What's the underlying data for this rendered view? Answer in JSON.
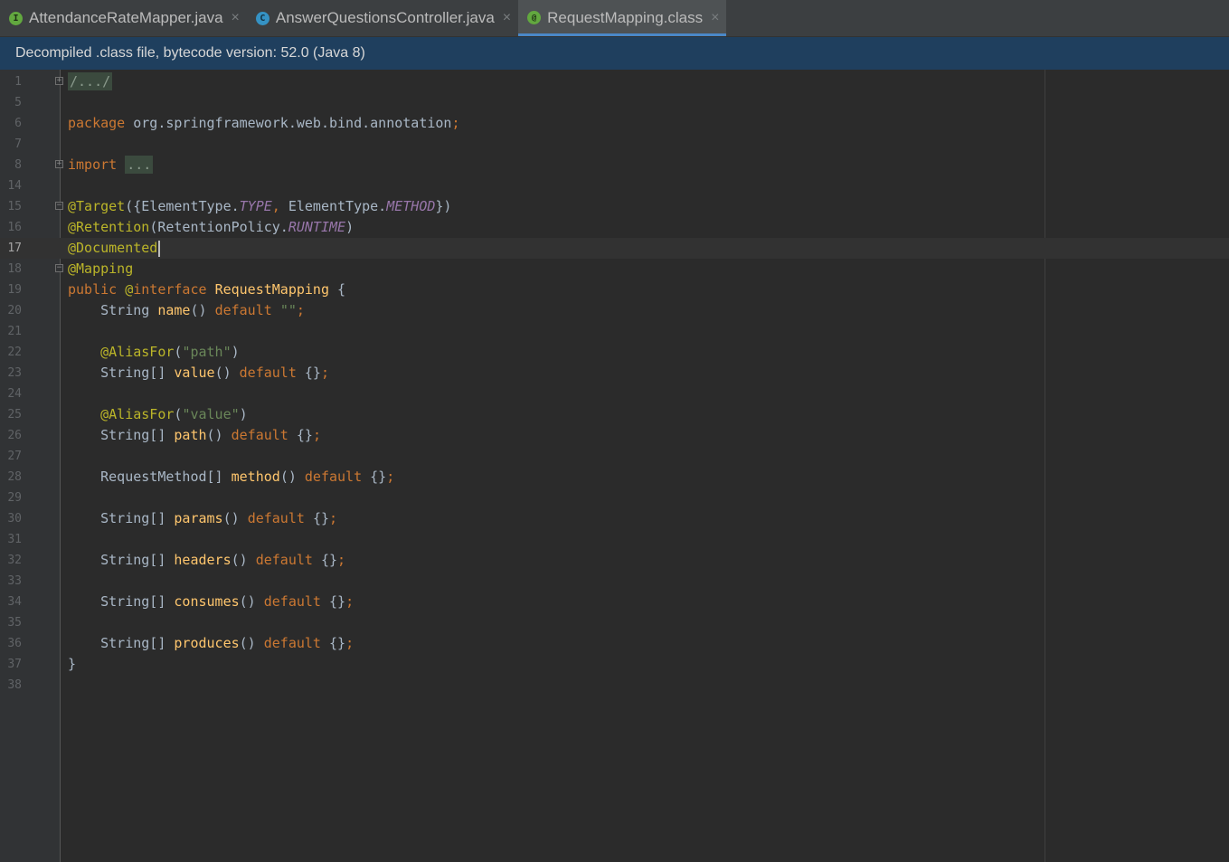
{
  "tabs": [
    {
      "label": "AttendanceRateMapper.java",
      "icon": "I",
      "icon_name": "interface-icon",
      "active": false
    },
    {
      "label": "AnswerQuestionsController.java",
      "icon": "C",
      "icon_name": "class-icon",
      "active": false
    },
    {
      "label": "RequestMapping.class",
      "icon": "@",
      "icon_name": "annotation-icon",
      "active": true
    }
  ],
  "tab_close_glyph": "×",
  "banner": "Decompiled .class file, bytecode version: 52.0 (Java 8)",
  "current_line": "17",
  "lines": [
    {
      "n": "1",
      "fold": "+",
      "tokens": [
        [
          "folded",
          "/.../"
        ]
      ]
    },
    {
      "n": "5",
      "tokens": []
    },
    {
      "n": "6",
      "tokens": [
        [
          "kw",
          "package "
        ],
        [
          "",
          "org.springframework.web.bind.annotation"
        ],
        [
          "kw",
          ";"
        ]
      ]
    },
    {
      "n": "7",
      "tokens": []
    },
    {
      "n": "8",
      "fold": "+",
      "tokens": [
        [
          "kw",
          "import "
        ],
        [
          "folded",
          "..."
        ]
      ]
    },
    {
      "n": "14",
      "tokens": []
    },
    {
      "n": "15",
      "fold": "-",
      "tokens": [
        [
          "an",
          "@Target"
        ],
        [
          "",
          "({ElementType."
        ],
        [
          "it",
          "TYPE"
        ],
        [
          "kw",
          ", "
        ],
        [
          "",
          "ElementType."
        ],
        [
          "it",
          "METHOD"
        ],
        [
          "",
          "})"
        ]
      ]
    },
    {
      "n": "16",
      "tokens": [
        [
          "an",
          "@Retention"
        ],
        [
          "",
          "(RetentionPolicy."
        ],
        [
          "it",
          "RUNTIME"
        ],
        [
          "",
          ")"
        ]
      ]
    },
    {
      "n": "17",
      "tokens": [
        [
          "an",
          "@Documented"
        ]
      ]
    },
    {
      "n": "18",
      "fold": "-",
      "tokens": [
        [
          "an",
          "@Mapping"
        ]
      ]
    },
    {
      "n": "19",
      "tokens": [
        [
          "kw",
          "public "
        ],
        [
          "an",
          "@"
        ],
        [
          "kw",
          "interface "
        ],
        [
          "fn",
          "RequestMapping"
        ],
        [
          "",
          " {"
        ]
      ]
    },
    {
      "n": "20",
      "tokens": [
        [
          "",
          "    String "
        ],
        [
          "fn",
          "name"
        ],
        [
          "",
          "() "
        ],
        [
          "kw",
          "default "
        ],
        [
          "st",
          "\"\""
        ],
        [
          "kw",
          ";"
        ]
      ]
    },
    {
      "n": "21",
      "tokens": []
    },
    {
      "n": "22",
      "tokens": [
        [
          "",
          "    "
        ],
        [
          "an",
          "@AliasFor"
        ],
        [
          "",
          "("
        ],
        [
          "st",
          "\"path\""
        ],
        [
          "",
          ")"
        ]
      ]
    },
    {
      "n": "23",
      "tokens": [
        [
          "",
          "    String[] "
        ],
        [
          "fn",
          "value"
        ],
        [
          "",
          "() "
        ],
        [
          "kw",
          "default "
        ],
        [
          "",
          "{}"
        ],
        [
          "kw",
          ";"
        ]
      ]
    },
    {
      "n": "24",
      "tokens": []
    },
    {
      "n": "25",
      "tokens": [
        [
          "",
          "    "
        ],
        [
          "an",
          "@AliasFor"
        ],
        [
          "",
          "("
        ],
        [
          "st",
          "\"value\""
        ],
        [
          "",
          ")"
        ]
      ]
    },
    {
      "n": "26",
      "tokens": [
        [
          "",
          "    String[] "
        ],
        [
          "fn",
          "path"
        ],
        [
          "",
          "() "
        ],
        [
          "kw",
          "default "
        ],
        [
          "",
          "{}"
        ],
        [
          "kw",
          ";"
        ]
      ]
    },
    {
      "n": "27",
      "tokens": []
    },
    {
      "n": "28",
      "tokens": [
        [
          "",
          "    RequestMethod[] "
        ],
        [
          "fn",
          "method"
        ],
        [
          "",
          "() "
        ],
        [
          "kw",
          "default "
        ],
        [
          "",
          "{}"
        ],
        [
          "kw",
          ";"
        ]
      ]
    },
    {
      "n": "29",
      "tokens": []
    },
    {
      "n": "30",
      "tokens": [
        [
          "",
          "    String[] "
        ],
        [
          "fn",
          "params"
        ],
        [
          "",
          "() "
        ],
        [
          "kw",
          "default "
        ],
        [
          "",
          "{}"
        ],
        [
          "kw",
          ";"
        ]
      ]
    },
    {
      "n": "31",
      "tokens": []
    },
    {
      "n": "32",
      "tokens": [
        [
          "",
          "    String[] "
        ],
        [
          "fn",
          "headers"
        ],
        [
          "",
          "() "
        ],
        [
          "kw",
          "default "
        ],
        [
          "",
          "{}"
        ],
        [
          "kw",
          ";"
        ]
      ]
    },
    {
      "n": "33",
      "tokens": []
    },
    {
      "n": "34",
      "tokens": [
        [
          "",
          "    String[] "
        ],
        [
          "fn",
          "consumes"
        ],
        [
          "",
          "() "
        ],
        [
          "kw",
          "default "
        ],
        [
          "",
          "{}"
        ],
        [
          "kw",
          ";"
        ]
      ]
    },
    {
      "n": "35",
      "tokens": []
    },
    {
      "n": "36",
      "tokens": [
        [
          "",
          "    String[] "
        ],
        [
          "fn",
          "produces"
        ],
        [
          "",
          "() "
        ],
        [
          "kw",
          "default "
        ],
        [
          "",
          "{}"
        ],
        [
          "kw",
          ";"
        ]
      ]
    },
    {
      "n": "37",
      "tokens": [
        [
          "",
          "}"
        ]
      ]
    },
    {
      "n": "38",
      "tokens": []
    }
  ]
}
